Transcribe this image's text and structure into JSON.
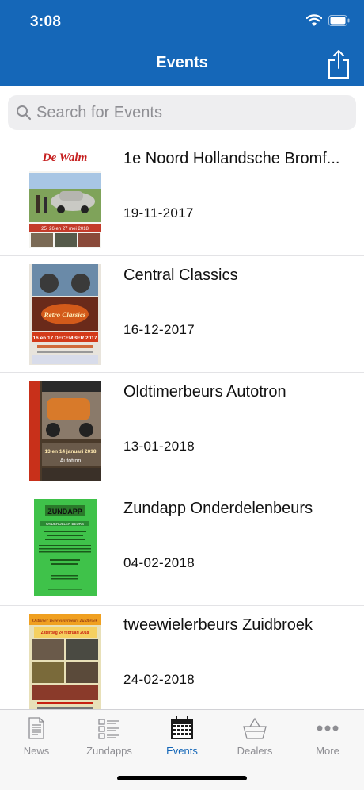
{
  "status_bar": {
    "time": "3:08",
    "icons": [
      "wifi-icon",
      "battery-icon"
    ]
  },
  "nav": {
    "title": "Events",
    "share_icon": "share-icon"
  },
  "search": {
    "placeholder": "Search for Events",
    "value": ""
  },
  "events": [
    {
      "title": "1e Noord Hollandsche Bromf...",
      "date": "19-11-2017",
      "poster_text": "De Walm",
      "poster_sub": "25, 26 en 27 mei 2018"
    },
    {
      "title": "Central Classics",
      "date": "16-12-2017",
      "poster_text": "16 en 17 DECEMBER 2017",
      "poster_sub": "Retro Classics"
    },
    {
      "title": "Oldtimerbeurs Autotron",
      "date": "13-01-2018",
      "poster_text": "13 en 14 januari 2018",
      "poster_sub": "Autotron"
    },
    {
      "title": "Zundapp Onderdelenbeurs",
      "date": "04-02-2018",
      "poster_text": "ZÜNDAPP",
      "poster_sub": "ONDERDELEN BEURS"
    },
    {
      "title": "tweewielerbeurs Zuidbroek",
      "date": "24-02-2018",
      "poster_text": "Oldtimer Tweewielerbeurs Zuidbroek",
      "poster_sub": "Zaterdag 24 februari 2018"
    }
  ],
  "tabs": [
    {
      "label": "News",
      "icon": "newspaper-icon",
      "active": false
    },
    {
      "label": "Zundapps",
      "icon": "list-icon",
      "active": false
    },
    {
      "label": "Events",
      "icon": "calendar-icon",
      "active": true
    },
    {
      "label": "Dealers",
      "icon": "basket-icon",
      "active": false
    },
    {
      "label": "More",
      "icon": "more-icon",
      "active": false
    }
  ],
  "colors": {
    "accent": "#1567b8",
    "inactive": "#8e8e93",
    "divider": "#e3e3e6"
  }
}
